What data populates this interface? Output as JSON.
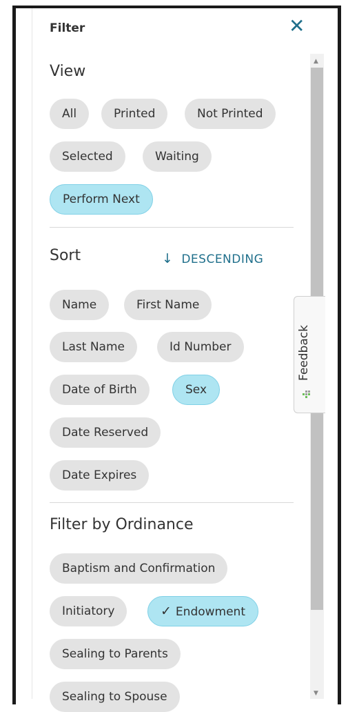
{
  "panel": {
    "title": "Filter",
    "close_icon": "close-icon"
  },
  "view": {
    "heading": "View",
    "chips": [
      {
        "label": "All",
        "active": false
      },
      {
        "label": "Printed",
        "active": false
      },
      {
        "label": "Not Printed",
        "active": false
      },
      {
        "label": "Selected",
        "active": false
      },
      {
        "label": "Waiting",
        "active": false
      },
      {
        "label": "Perform Next",
        "active": true
      }
    ]
  },
  "sort": {
    "heading": "Sort",
    "direction_label": "DESCENDING",
    "direction_icon": "arrow-down-icon",
    "chips": [
      {
        "label": "Name",
        "active": false
      },
      {
        "label": "First Name",
        "active": false
      },
      {
        "label": "Last Name",
        "active": false
      },
      {
        "label": "Id Number",
        "active": false
      },
      {
        "label": "Date of Birth",
        "active": false
      },
      {
        "label": "Sex",
        "active": true
      },
      {
        "label": "Date Reserved",
        "active": false
      },
      {
        "label": "Date Expires",
        "active": false
      }
    ]
  },
  "ordinance": {
    "heading": "Filter by Ordinance",
    "chips": [
      {
        "label": "Baptism and Confirmation",
        "active": false
      },
      {
        "label": "Initiatory",
        "active": false
      },
      {
        "label": "Endowment",
        "active": true,
        "check_icon": "check-icon"
      },
      {
        "label": "Sealing to Parents",
        "active": false
      },
      {
        "label": "Sealing to Spouse",
        "active": false
      }
    ]
  },
  "feedback": {
    "label": "Feedback",
    "icon": "feedback-icon"
  },
  "colors": {
    "accent": "#1f6f8b",
    "chip": "#e3e3e3",
    "chip_active": "#aee5f2"
  }
}
